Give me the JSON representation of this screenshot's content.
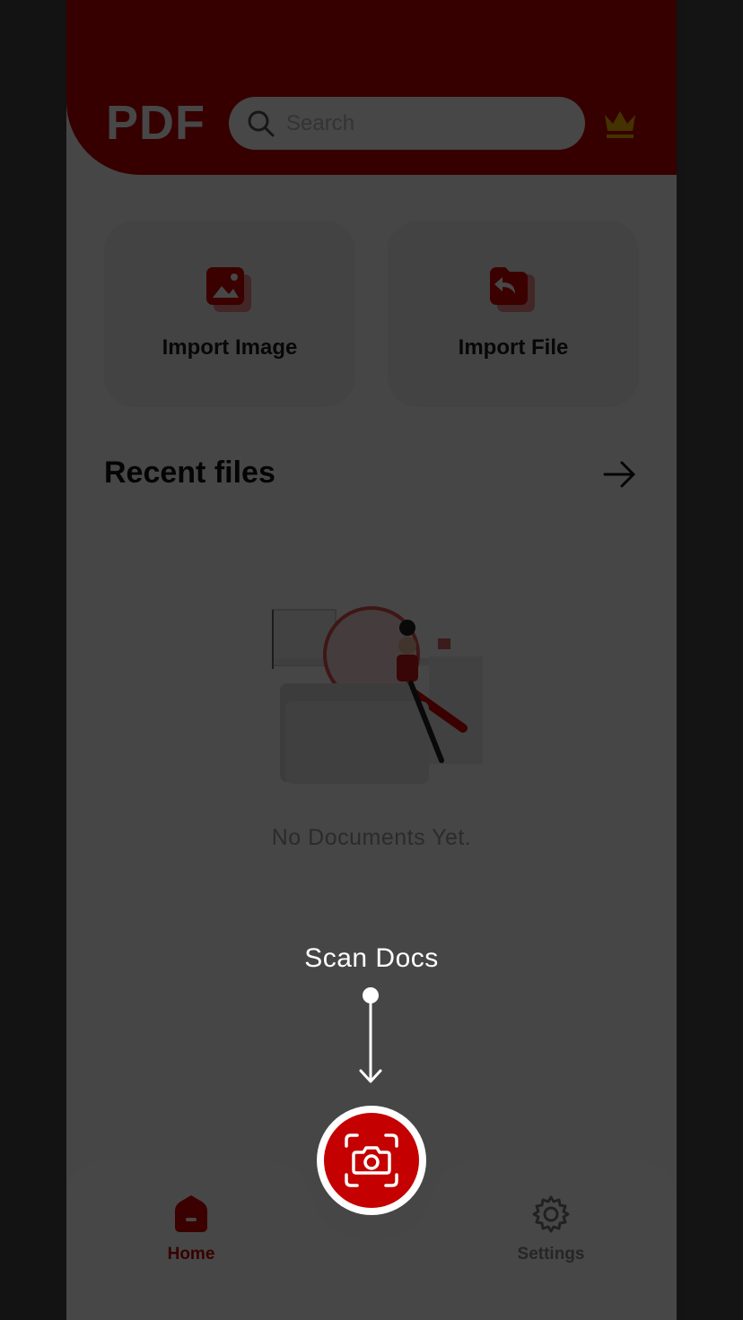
{
  "header": {
    "logo": "PDF",
    "search_placeholder": "Search",
    "crown_icon": "crown-icon"
  },
  "actions": [
    {
      "label": "Import Image",
      "icon": "image-icon"
    },
    {
      "label": "Import File",
      "icon": "file-import-icon"
    }
  ],
  "recent": {
    "title": "Recent files",
    "empty_text": "No Documents Yet."
  },
  "tabbar": {
    "home": "Home",
    "settings": "Settings"
  },
  "coachmark": {
    "label": "Scan Docs"
  },
  "colors": {
    "brand": "#c00000",
    "overlay": "rgba(0,0,0,0.72)"
  }
}
